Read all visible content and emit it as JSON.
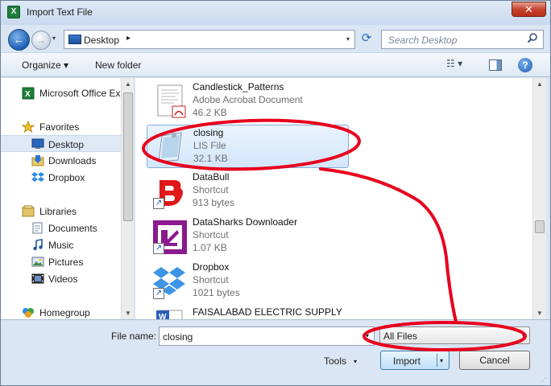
{
  "window": {
    "title": "Import Text File",
    "close_glyph": "✕",
    "app_icon": "excel-icon"
  },
  "address_bar": {
    "crumb": "Desktop",
    "crumb_arrow": "▸",
    "dropdown_glyph": "▾",
    "refresh_glyph": "⟳",
    "back_glyph": "←",
    "forward_glyph": "→"
  },
  "search": {
    "placeholder": "Search Desktop",
    "icon": "🔍"
  },
  "toolbar": {
    "organize_label": "Organize ▾",
    "new_folder_label": "New folder",
    "views_glyph": "☷ ▾",
    "help_glyph": "?"
  },
  "navigation": {
    "items": [
      {
        "label": "Microsoft Office Ex",
        "icon": "excel-icon"
      },
      {
        "label": "Favorites",
        "icon": "star-icon"
      },
      {
        "label": "Desktop",
        "icon": "desktop-icon"
      },
      {
        "label": "Downloads",
        "icon": "downloads-icon"
      },
      {
        "label": "Dropbox",
        "icon": "dropbox-icon"
      },
      {
        "label": "Libraries",
        "icon": "libraries-icon"
      },
      {
        "label": "Documents",
        "icon": "documents-icon"
      },
      {
        "label": "Music",
        "icon": "music-icon"
      },
      {
        "label": "Pictures",
        "icon": "pictures-icon"
      },
      {
        "label": "Videos",
        "icon": "videos-icon"
      },
      {
        "label": "Homegroup",
        "icon": "homegroup-icon"
      }
    ],
    "selected": "Desktop"
  },
  "files": [
    {
      "name": "Candlestick_Patterns",
      "type": "Adobe Acrobat Document",
      "size": "46.2 KB",
      "icon": "pdf-document-icon"
    },
    {
      "name": "closing",
      "type": "LIS File",
      "size": "32.1 KB",
      "icon": "lis-file-icon"
    },
    {
      "name": "DataBull",
      "type": "Shortcut",
      "size": "913 bytes",
      "icon": "databull-icon"
    },
    {
      "name": "DataSharks Downloader",
      "type": "Shortcut",
      "size": "1.07 KB",
      "icon": "datasharks-icon"
    },
    {
      "name": "Dropbox",
      "type": "Shortcut",
      "size": "1021 bytes",
      "icon": "dropbox-icon"
    },
    {
      "name": "FAISALABAD ELECTRIC SUPPLY",
      "type": "",
      "size": "",
      "icon": "word-document-icon"
    }
  ],
  "selected_file": "closing",
  "bottom": {
    "file_name_label": "File name:",
    "file_name_value": "closing",
    "filter_value": "All Files",
    "tools_label": "Tools",
    "import_label": "Import",
    "cancel_label": "Cancel",
    "dropdown_glyph": "▾"
  },
  "colors": {
    "accent": "#3c7fb1",
    "annotation_red": "#e8001c",
    "selection": "#d3e6fb"
  }
}
